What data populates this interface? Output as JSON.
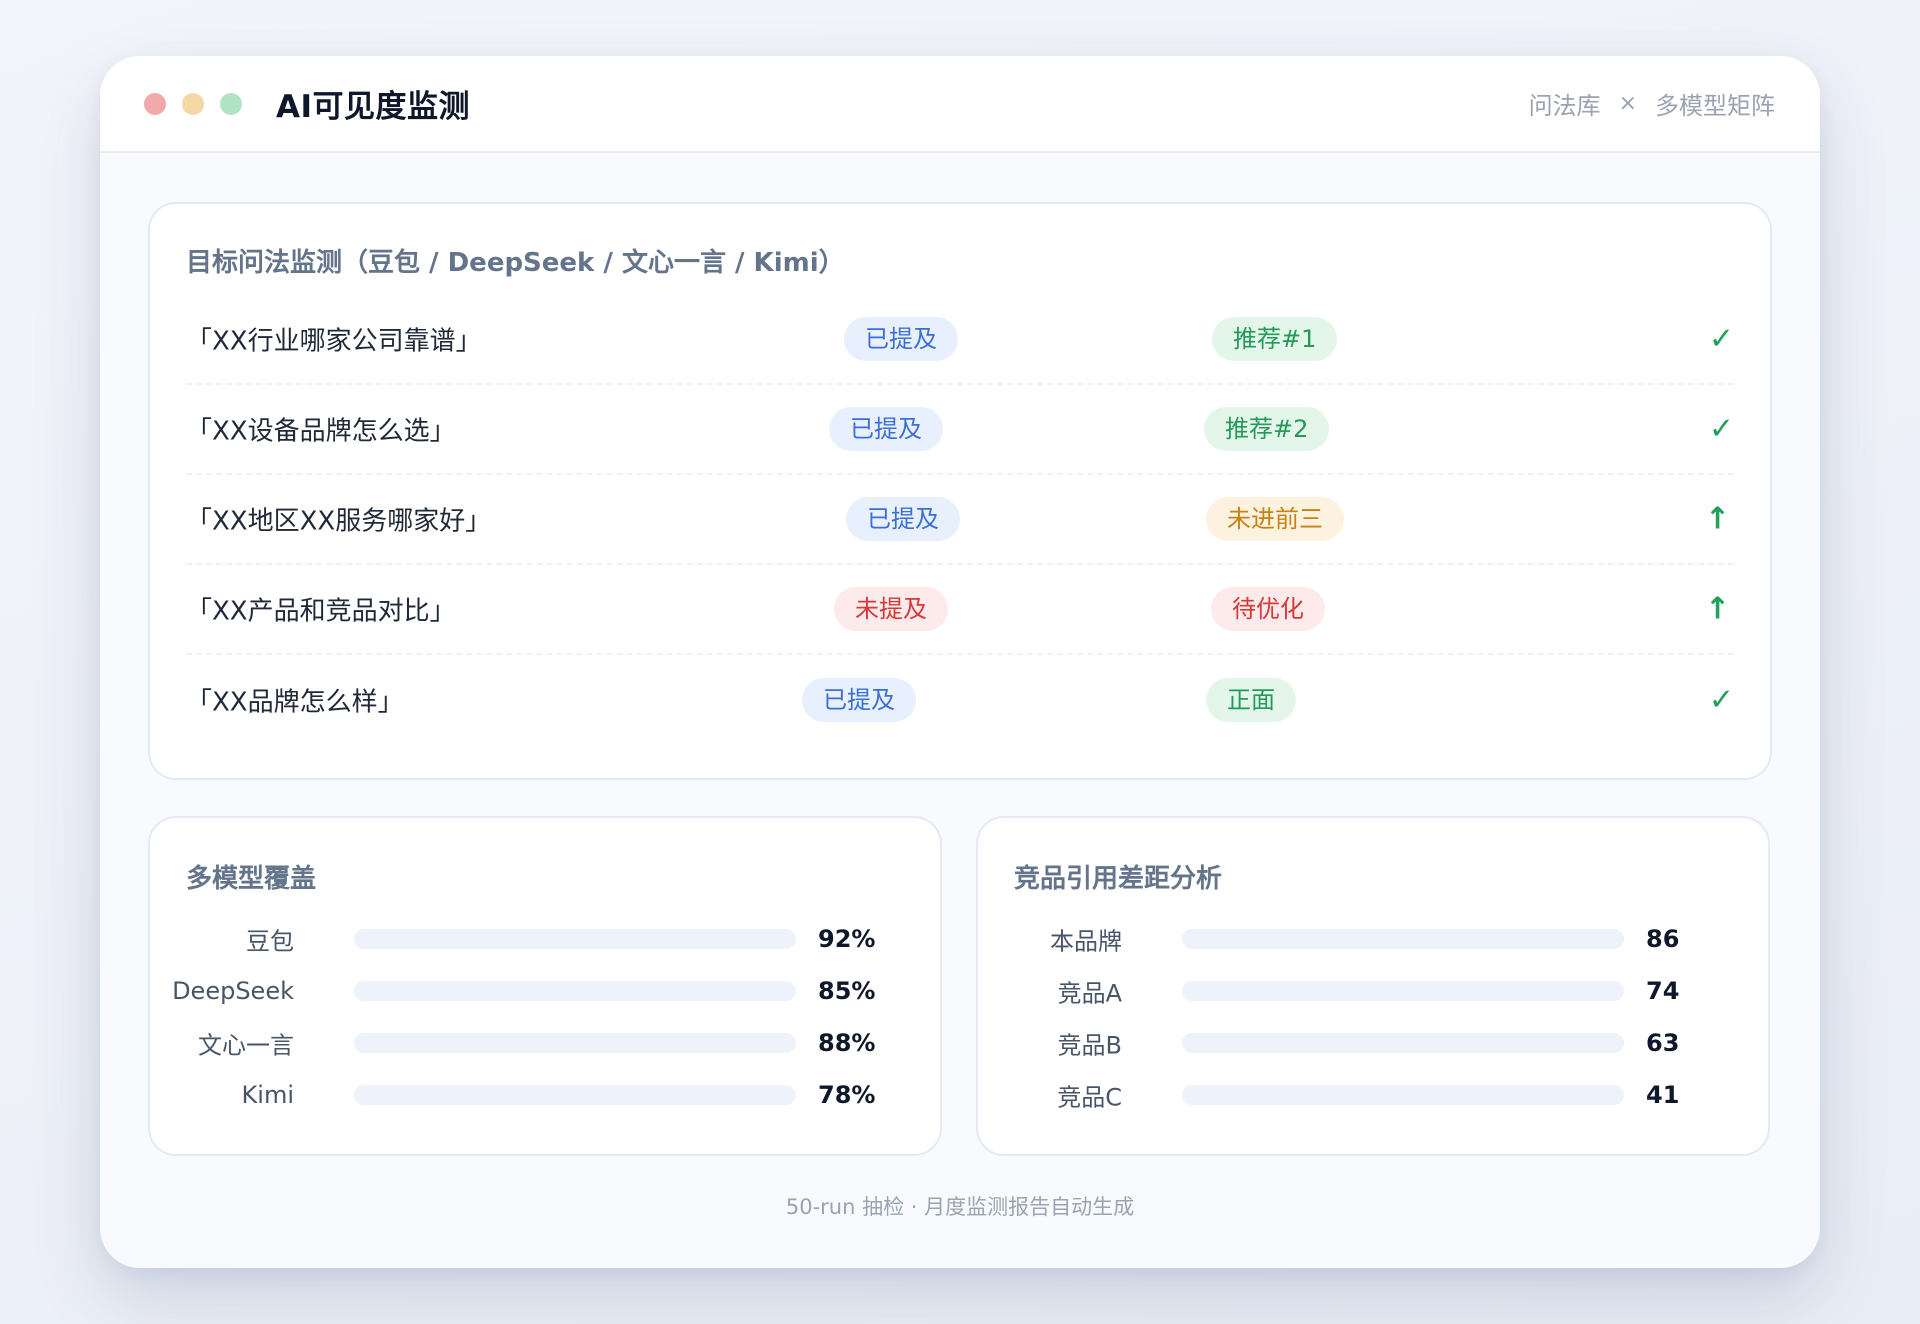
{
  "window": {
    "title": "AI可见度监测",
    "subtitle_left": "问法库",
    "subtitle_sep": "×",
    "subtitle_right": "多模型矩阵"
  },
  "monitor": {
    "title": "目标问法监测（豆包 / DeepSeek / 文心一言 / Kimi）",
    "rows": [
      {
        "query": "「XX行业哪家公司靠谱」",
        "mention": "已提及",
        "mention_tone": "blue",
        "rank": "推荐#1",
        "rank_tone": "green",
        "mark": "✓"
      },
      {
        "query": "「XX设备品牌怎么选」",
        "mention": "已提及",
        "mention_tone": "blue",
        "rank": "推荐#2",
        "rank_tone": "green",
        "mark": "✓"
      },
      {
        "query": "「XX地区XX服务哪家好」",
        "mention": "已提及",
        "mention_tone": "blue",
        "rank": "未进前三",
        "rank_tone": "amber",
        "mark": "↑"
      },
      {
        "query": "「XX产品和竞品对比」",
        "mention": "未提及",
        "mention_tone": "red",
        "rank": "待优化",
        "rank_tone": "red",
        "mark": "↑"
      },
      {
        "query": "「XX品牌怎么样」",
        "mention": "已提及",
        "mention_tone": "blue",
        "rank": "正面",
        "rank_tone": "green",
        "mark": "✓"
      }
    ]
  },
  "coverage": {
    "title": "多模型覆盖",
    "items": [
      {
        "label": "豆包",
        "value": "92%",
        "fraction": 0.92
      },
      {
        "label": "DeepSeek",
        "value": "85%",
        "fraction": 0.85
      },
      {
        "label": "文心一言",
        "value": "88%",
        "fraction": 0.88
      },
      {
        "label": "Kimi",
        "value": "78%",
        "fraction": 0.78
      }
    ]
  },
  "compete": {
    "title": "竞品引用差距分析",
    "items": [
      {
        "label": "本品牌",
        "value": "86",
        "fraction": 0.86
      },
      {
        "label": "竞品A",
        "value": "74",
        "fraction": 0.74
      },
      {
        "label": "竞品B",
        "value": "63",
        "fraction": 0.63
      },
      {
        "label": "竞品C",
        "value": "41",
        "fraction": 0.41
      }
    ]
  },
  "footer": "50-run 抽检 · 月度监测报告自动生成",
  "colors": {
    "accent_blue": "#3b6fd6",
    "positive_green": "#23995a",
    "warning_amber": "#c48312",
    "negative_red": "#d63838"
  }
}
